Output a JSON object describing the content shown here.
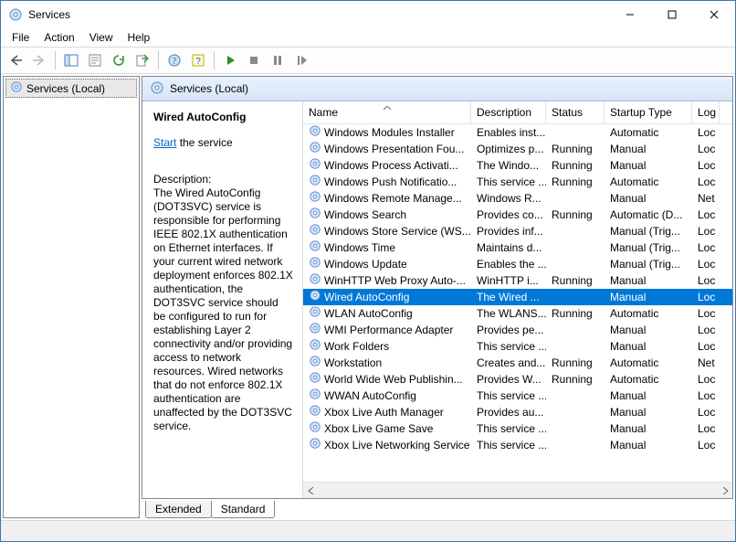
{
  "window_title": "Services",
  "menu": [
    "File",
    "Action",
    "View",
    "Help"
  ],
  "tree_item": "Services (Local)",
  "pane_header": "Services (Local)",
  "detail": {
    "name": "Wired AutoConfig",
    "action_link": "Start",
    "action_suffix": " the service",
    "desc_label": "Description:",
    "description": "The Wired AutoConfig (DOT3SVC) service is responsible for performing IEEE 802.1X authentication on Ethernet interfaces. If your current wired network deployment enforces 802.1X authentication, the DOT3SVC service should be configured to run for establishing Layer 2 connectivity and/or providing access to network resources. Wired networks that do not enforce 802.1X authentication are unaffected by the DOT3SVC service."
  },
  "columns": [
    "Name",
    "Description",
    "Status",
    "Startup Type",
    "Log"
  ],
  "tabs": [
    "Extended",
    "Standard"
  ],
  "selected_index": 10,
  "services": [
    {
      "name": "Windows Modules Installer",
      "desc": "Enables inst...",
      "status": "",
      "startup": "Automatic",
      "logon": "Loc"
    },
    {
      "name": "Windows Presentation Fou...",
      "desc": "Optimizes p...",
      "status": "Running",
      "startup": "Manual",
      "logon": "Loc"
    },
    {
      "name": "Windows Process Activati...",
      "desc": "The Windo...",
      "status": "Running",
      "startup": "Manual",
      "logon": "Loc"
    },
    {
      "name": "Windows Push Notificatio...",
      "desc": "This service ...",
      "status": "Running",
      "startup": "Automatic",
      "logon": "Loc"
    },
    {
      "name": "Windows Remote Manage...",
      "desc": "Windows R...",
      "status": "",
      "startup": "Manual",
      "logon": "Net"
    },
    {
      "name": "Windows Search",
      "desc": "Provides co...",
      "status": "Running",
      "startup": "Automatic (D...",
      "logon": "Loc"
    },
    {
      "name": "Windows Store Service (WS...",
      "desc": "Provides inf...",
      "status": "",
      "startup": "Manual (Trig...",
      "logon": "Loc"
    },
    {
      "name": "Windows Time",
      "desc": "Maintains d...",
      "status": "",
      "startup": "Manual (Trig...",
      "logon": "Loc"
    },
    {
      "name": "Windows Update",
      "desc": "Enables the ...",
      "status": "",
      "startup": "Manual (Trig...",
      "logon": "Loc"
    },
    {
      "name": "WinHTTP Web Proxy Auto-...",
      "desc": "WinHTTP i...",
      "status": "Running",
      "startup": "Manual",
      "logon": "Loc"
    },
    {
      "name": "Wired AutoConfig",
      "desc": "The Wired ...",
      "status": "",
      "startup": "Manual",
      "logon": "Loc"
    },
    {
      "name": "WLAN AutoConfig",
      "desc": "The WLANS...",
      "status": "Running",
      "startup": "Automatic",
      "logon": "Loc"
    },
    {
      "name": "WMI Performance Adapter",
      "desc": "Provides pe...",
      "status": "",
      "startup": "Manual",
      "logon": "Loc"
    },
    {
      "name": "Work Folders",
      "desc": "This service ...",
      "status": "",
      "startup": "Manual",
      "logon": "Loc"
    },
    {
      "name": "Workstation",
      "desc": "Creates and...",
      "status": "Running",
      "startup": "Automatic",
      "logon": "Net"
    },
    {
      "name": "World Wide Web Publishin...",
      "desc": "Provides W...",
      "status": "Running",
      "startup": "Automatic",
      "logon": "Loc"
    },
    {
      "name": "WWAN AutoConfig",
      "desc": "This service ...",
      "status": "",
      "startup": "Manual",
      "logon": "Loc"
    },
    {
      "name": "Xbox Live Auth Manager",
      "desc": "Provides au...",
      "status": "",
      "startup": "Manual",
      "logon": "Loc"
    },
    {
      "name": "Xbox Live Game Save",
      "desc": "This service ...",
      "status": "",
      "startup": "Manual",
      "logon": "Loc"
    },
    {
      "name": "Xbox Live Networking Service",
      "desc": "This service ...",
      "status": "",
      "startup": "Manual",
      "logon": "Loc"
    }
  ]
}
